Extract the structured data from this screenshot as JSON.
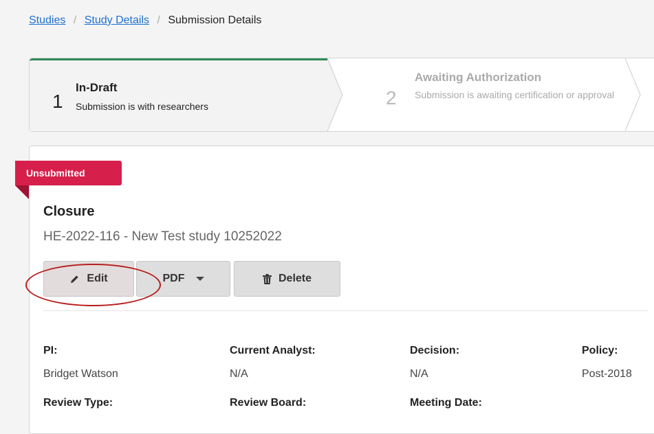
{
  "breadcrumb": {
    "items": [
      "Studies",
      "Study Details"
    ],
    "current": "Submission Details",
    "separator": "/"
  },
  "stepper": {
    "steps": [
      {
        "number": "1",
        "title": "In-Draft",
        "description": "Submission is with researchers",
        "state": "active"
      },
      {
        "number": "2",
        "title": "Awaiting Authorization",
        "description": "Submission is awaiting certification or approval",
        "state": "pending"
      }
    ]
  },
  "submission": {
    "status_badge": "Unsubmitted",
    "title": "Closure",
    "study": "HE-2022-116 - New Test study 10252022"
  },
  "actions": {
    "edit_label": "Edit",
    "pdf_label": "PDF",
    "delete_label": "Delete"
  },
  "details": {
    "row1": [
      {
        "label": "PI:",
        "value": "Bridget Watson"
      },
      {
        "label": "Current Analyst:",
        "value": "N/A"
      },
      {
        "label": "Decision:",
        "value": "N/A"
      },
      {
        "label": "Policy:",
        "value": "Post-2018"
      }
    ],
    "row2": [
      {
        "label": "Review Type:"
      },
      {
        "label": "Review Board:"
      },
      {
        "label": "Meeting Date:"
      }
    ]
  },
  "colors": {
    "link": "#1f6fd1",
    "badge": "#d61f4b",
    "active_step_bar": "#2e8b57",
    "highlight": "#b71c1c"
  },
  "icons": {
    "edit": "pencil-icon",
    "pdf_menu": "caret-down-icon",
    "delete": "trash-icon"
  }
}
